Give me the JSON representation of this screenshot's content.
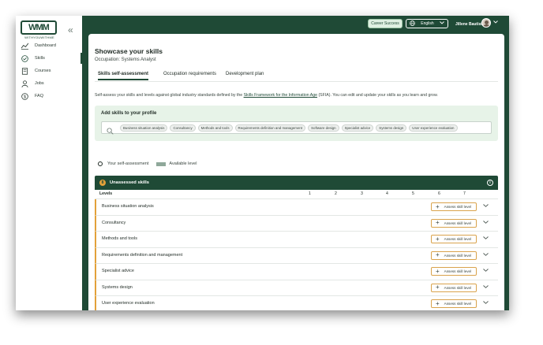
{
  "colors": {
    "brand_green": "#1f4a36",
    "accent_orange": "#e3a13a",
    "light_green": "#e7f3e8"
  },
  "sidebar": {
    "logo_text": "WMM",
    "logo_sub": "WITHYOUWITHME",
    "collapse_icon": "double-chevron-left-icon",
    "items": [
      {
        "label": "Dashboard",
        "icon": "chart-line-icon",
        "active": false
      },
      {
        "label": "Skills",
        "icon": "check-circle-icon",
        "active": true
      },
      {
        "label": "Courses",
        "icon": "book-icon",
        "active": false
      },
      {
        "label": "Jobs",
        "icon": "person-icon",
        "active": false
      },
      {
        "label": "FAQ",
        "icon": "question-circle-icon",
        "active": false
      }
    ]
  },
  "topbar": {
    "career_label": "Career Success",
    "language_label": "English",
    "user_name": "Jillene Bautista"
  },
  "page": {
    "title": "Showcase your skills",
    "subtitle": "Occupation: Systems Analyst",
    "tabs": [
      {
        "label": "Skills self-assessment",
        "active": true
      },
      {
        "label": "Occupation requirements",
        "active": false
      },
      {
        "label": "Development plan",
        "active": false
      }
    ],
    "description_before": "Self-assess your skills and levels against global industry standards defined by the ",
    "description_link": "Skills Framework for the Information Age",
    "description_after": " (SFIA). You can edit and update your skills as you learn and grow."
  },
  "add_skills": {
    "title": "Add skills to your profile",
    "chips": [
      "Business situation analysis",
      "Consultancy",
      "Methods and tools",
      "Requirements definition and management",
      "Software design",
      "Specialist advice",
      "Systems design",
      "User experience evaluation"
    ]
  },
  "legend": {
    "self_label": "Your self-assessment",
    "available_label": "Available level"
  },
  "unassessed": {
    "count": "8",
    "title": "Unassessed skills",
    "levels_label": "Levels",
    "levels": [
      "1",
      "2",
      "3",
      "4",
      "5",
      "6",
      "7"
    ],
    "assess_label": "Assess skill level",
    "skills": [
      "Business situation analysis",
      "Consultancy",
      "Methods and tools",
      "Requirements definition and management",
      "Specialist advice",
      "Systems design",
      "User experience evaluation"
    ]
  }
}
